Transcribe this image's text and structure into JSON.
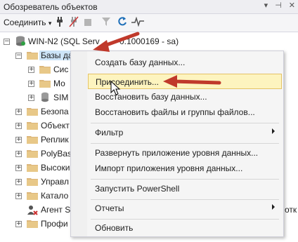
{
  "panel": {
    "title": "Обозреватель объектов",
    "title_icons": [
      "pin-icon",
      "close-icon"
    ]
  },
  "toolbar": {
    "connect_label": "Соединить",
    "icons": [
      "connect-dropdown-icon",
      "plug-icon",
      "disconnect-icon",
      "stop-icon",
      "filter-icon",
      "refresh-icon",
      "activity-icon"
    ]
  },
  "tree": {
    "server": "WIN-N2 (SQL Serv",
    "server_tail": "0.1000169 - sa)",
    "databases": "Базы данных",
    "children": [
      {
        "label": "Сис"
      },
      {
        "label": "Мо"
      },
      {
        "label": "SIM"
      }
    ],
    "nodes": [
      {
        "label": "Безопа"
      },
      {
        "label": "Объект"
      },
      {
        "label": "Реплик"
      },
      {
        "label": "PolyBas"
      },
      {
        "label": "Высоки"
      },
      {
        "label": "Управл"
      },
      {
        "label": "Катало"
      },
      {
        "label": "Агент S"
      },
      {
        "label": "Профи"
      }
    ],
    "overflow_text": "отк"
  },
  "context_menu": {
    "items": [
      {
        "label": "Создать базу данных...",
        "submenu": false
      },
      {
        "label": "Присоединить...",
        "submenu": false,
        "highlighted": true
      },
      {
        "label": "Восстановить базу данных...",
        "submenu": false
      },
      {
        "label": "Восстановить файлы и группы файлов...",
        "submenu": false
      },
      {
        "label": "Фильтр",
        "submenu": true
      },
      {
        "label": "Развернуть приложение уровня данных...",
        "submenu": false
      },
      {
        "label": "Импорт приложения уровня данных...",
        "submenu": false
      },
      {
        "label": "Запустить PowerShell",
        "submenu": false
      },
      {
        "label": "Отчеты",
        "submenu": true
      },
      {
        "label": "Обновить",
        "submenu": false
      }
    ]
  },
  "colors": {
    "arrow": "#c0392b",
    "selection": "#cce4f7",
    "menu_highlight": "#fdf4bf",
    "folder": "#dcb67a"
  }
}
